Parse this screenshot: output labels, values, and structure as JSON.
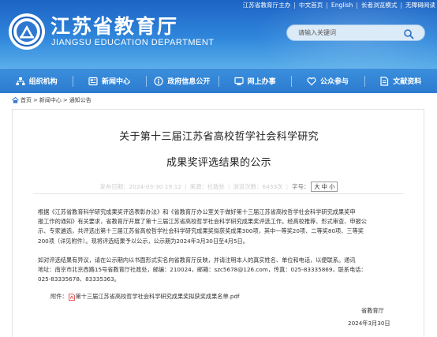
{
  "toplinks": {
    "items": [
      "江苏省教育厅主办",
      "中文首页",
      "English",
      "长者浏览模式",
      "无障碍阅读"
    ],
    "separator": "|"
  },
  "header": {
    "title": "江苏省教育厅",
    "subtitle": "JIANGSU EDUCATION DEPARTMENT",
    "logo_icon": "ministry-emblem-icon",
    "search": {
      "placeholder": "请输入关键词",
      "icon": "search-icon"
    },
    "colors": {
      "top": "#1d63c4",
      "bottom": "#59aee9"
    }
  },
  "nav": {
    "items": [
      {
        "label": "组织机构",
        "icon": "org-chart-icon"
      },
      {
        "label": "新闻中心",
        "icon": "news-icon"
      },
      {
        "label": "政府信息公开",
        "icon": "info-disclosure-icon"
      },
      {
        "label": "网上办事",
        "icon": "online-service-icon"
      },
      {
        "label": "公众参与",
        "icon": "heart-icon"
      },
      {
        "label": "文献资料",
        "icon": "documents-icon"
      }
    ]
  },
  "breadcrumb": {
    "icon": "home-icon",
    "items": [
      "首页",
      "新闻中心",
      "通知公告"
    ],
    "separator": ">"
  },
  "article": {
    "title_line1": "关于第十三届江苏省高校哲学社会科学研究",
    "title_line2": "成果奖评选结果的公示",
    "meta": {
      "date": "发布日期：2024-03-30 19:12",
      "source": "来源：社政处",
      "views": "浏览次数：6433次",
      "font_size_label": "字号：",
      "font_sizes": [
        "大",
        "中",
        "小"
      ]
    },
    "paragraph1": [
      "根据《江苏省教育科学研究成果奖评选表彰办法》和《省教育厅办公室关于做好第十三届江苏省高校哲学社会科学研究成果奖申",
      "报工作的通知》有关要求，省教育厅开展了第十三届江苏省高校哲学社会科学研究成果奖评选工作。经高校推荐、形式审查、申报公",
      "示、专家遴选，共评选出第十三届江苏省高校哲学社会科学研究成果奖拟获奖成果300项，其中一等奖20项、二等奖80项、三等奖",
      "200项（详见附件）。现将评选结果予以公示，公示期为2024年3月30日至4月5日。"
    ],
    "paragraph2": [
      "如对评选结果有异议，请在公示期内以书面形式实名向省教育厅反映，并请注明本人的真实姓名、单位和电话，以便联系。通讯",
      "地址：南京市北京西路15号省教育厅社政处，邮编：210024，邮箱：szc5678@126.com，传真：025-83335869，联系电话：",
      "025-83335678、83335363。"
    ],
    "attachment_label": "附件：",
    "attachment_icon": "pdf-icon",
    "attachment_name": "第十三届江苏省高校哲学社会科学研究成果奖拟获奖成果名单.pdf",
    "signature_org": "省教育厅",
    "signature_date": "2024年3月30日"
  }
}
